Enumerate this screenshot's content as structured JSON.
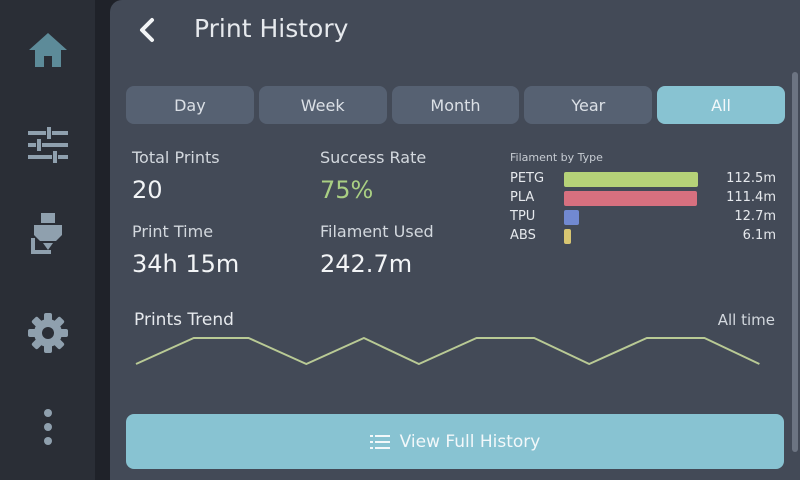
{
  "colors": {
    "accent": "#88c3d2",
    "success": "#a9cf83",
    "sidebar_icon": "#8fa0ae"
  },
  "sidebar": {
    "items": [
      {
        "icon": "home-icon"
      },
      {
        "icon": "sliders-icon"
      },
      {
        "icon": "extruder-icon"
      },
      {
        "icon": "gear-icon"
      },
      {
        "icon": "more-icon"
      }
    ]
  },
  "header": {
    "title": "Print History",
    "back_icon": "chevron-left-icon"
  },
  "tabs": [
    {
      "label": "Day",
      "active": false
    },
    {
      "label": "Week",
      "active": false
    },
    {
      "label": "Month",
      "active": false
    },
    {
      "label": "Year",
      "active": false
    },
    {
      "label": "All",
      "active": true
    }
  ],
  "stats": {
    "total_prints": {
      "label": "Total Prints",
      "value": "20"
    },
    "success_rate": {
      "label": "Success Rate",
      "value": "75%"
    },
    "print_time": {
      "label": "Print Time",
      "value": "34h 15m"
    },
    "filament_used": {
      "label": "Filament Used",
      "value": "242.7m"
    }
  },
  "filament": {
    "title": "Filament by Type",
    "max": 112.5,
    "items": [
      {
        "name": "PETG",
        "value": "112.5m",
        "amount": 112.5,
        "color": "#b5d278"
      },
      {
        "name": "PLA",
        "value": "111.4m",
        "amount": 111.4,
        "color": "#d7707f"
      },
      {
        "name": "TPU",
        "value": "12.7m",
        "amount": 12.7,
        "color": "#7189d1"
      },
      {
        "name": "ABS",
        "value": "6.1m",
        "amount": 6.1,
        "color": "#d8c672"
      }
    ]
  },
  "trend": {
    "title": "Prints Trend",
    "range": "All time",
    "values": [
      0,
      1,
      1,
      0,
      1,
      0,
      1,
      1,
      0,
      1,
      1,
      0
    ],
    "color": "#b9ca95"
  },
  "footer_button": {
    "label": "View Full History",
    "icon": "list-icon"
  }
}
